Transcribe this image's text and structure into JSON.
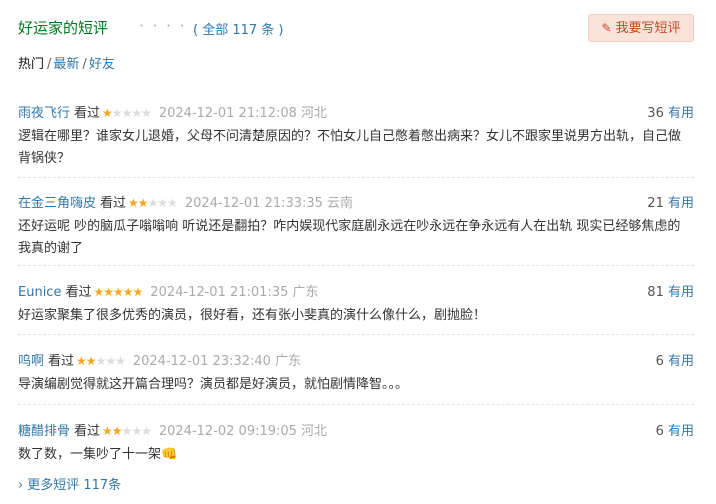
{
  "header": {
    "title": "好运家的短评",
    "dots": "· · · · · ·",
    "total": "( 全部 117 条 )",
    "write_button": "我要写短评"
  },
  "tabs": [
    {
      "label": "热门",
      "active": true
    },
    {
      "label": "最新",
      "active": false
    },
    {
      "label": "好友",
      "active": false
    }
  ],
  "comments": [
    {
      "user": "雨夜飞行",
      "seen": "看过",
      "rating": 1,
      "time": "2024-12-01 21:12:08",
      "location": "河北",
      "useful_count": "36",
      "useful_label": "有用",
      "text": "逻辑在哪里？谁家女儿退婚，父母不问清楚原因的？不怕女儿自己憋着憋出病来？女儿不跟家里说男方出轨，自己做背锅侠？"
    },
    {
      "user": "在金三角嗨皮",
      "seen": "看过",
      "rating": 2,
      "time": "2024-12-01 21:33:35",
      "location": "云南",
      "useful_count": "21",
      "useful_label": "有用",
      "text": "还好运呢 吵的脑瓜子嗡嗡响 听说还是翻拍？咋内娱现代家庭剧永远在吵永远在争永远有人在出轨 现实已经够焦虑的我真的谢了"
    },
    {
      "user": "Eunice",
      "seen": "看过",
      "rating": 5,
      "time": "2024-12-01 21:01:35",
      "location": "广东",
      "useful_count": "81",
      "useful_label": "有用",
      "text": "好运家聚集了很多优秀的演员，很好看，还有张小斐真的演什么像什么，剧抛脸！"
    },
    {
      "user": "呜啊",
      "seen": "看过",
      "rating": 2,
      "time": "2024-12-01 23:32:40",
      "location": "广东",
      "useful_count": "6",
      "useful_label": "有用",
      "text": "导演编剧觉得就这开篇合理吗？演员都是好演员，就怕剧情降智。。。"
    },
    {
      "user": "糖醋排骨",
      "seen": "看过",
      "rating": 2,
      "time": "2024-12-02 09:19:05",
      "location": "河北",
      "useful_count": "6",
      "useful_label": "有用",
      "text": "数了数，一集吵了十一架👊"
    }
  ],
  "more": {
    "label": "更多短评 117条",
    "arrow": "›"
  },
  "colors": {
    "accent": "#3377aa",
    "title": "#007722",
    "star": "#f5a623",
    "button_bg": "#f9e2d8"
  }
}
